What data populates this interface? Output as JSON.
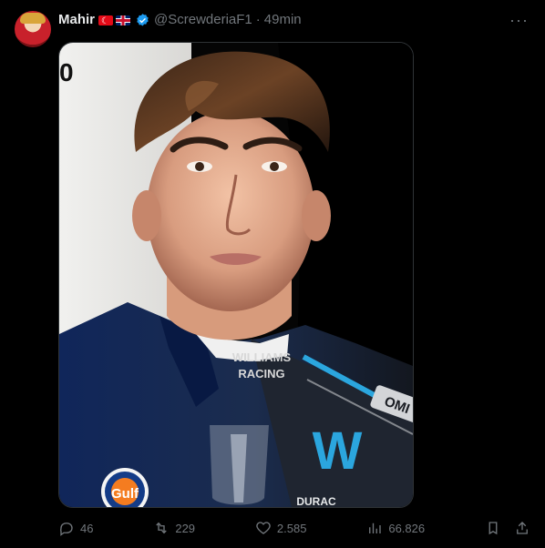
{
  "tweet": {
    "author_name": "Mahir",
    "author_flags": [
      "turkey-flag",
      "uk-flag"
    ],
    "handle": "@ScrewderiaF1",
    "separator": "·",
    "time": "49min",
    "more_icon": "ellipsis-icon"
  },
  "media": {
    "text_williams": "WILLIAMS",
    "text_racing": "RACING",
    "text_gulf": "Gulf",
    "text_oml": "OMI",
    "text_w": "W",
    "text_dura": "DURAC"
  },
  "actions": {
    "reply_count": "46",
    "retweet_count": "229",
    "like_count": "2.585",
    "views_count": "66.826"
  },
  "colors": {
    "background": "#000000",
    "text_primary": "#e7e9ea",
    "text_secondary": "#71767b",
    "verified": "#1d9bf0",
    "williams_navy": "#0f1f4a",
    "williams_cyan": "#2ba6de"
  }
}
